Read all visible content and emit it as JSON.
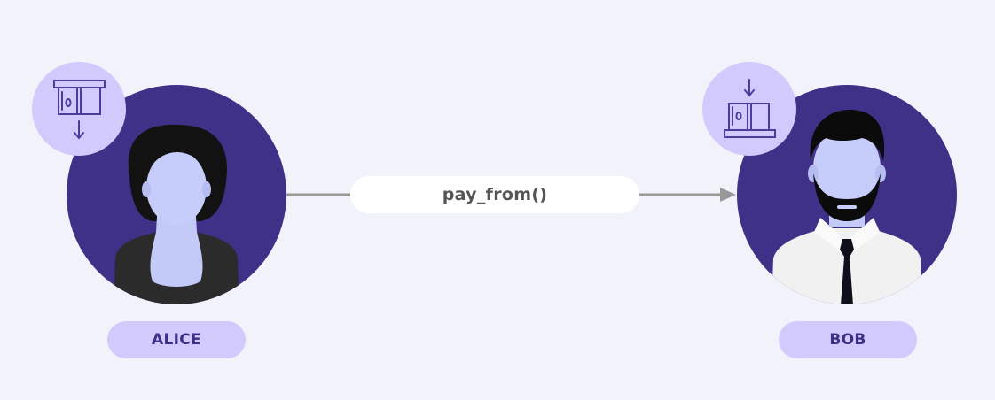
{
  "diagram": {
    "call": {
      "label": "pay_from()"
    },
    "sender": {
      "name": "ALICE",
      "badge_icon": "card-withdraw-icon"
    },
    "receiver": {
      "name": "BOB",
      "badge_icon": "card-deposit-icon"
    },
    "colors": {
      "background": "#f2f2fa",
      "avatar_circle": "#3f3187",
      "badge_circle": "#d2c9fc",
      "badge_icon": "#4a3d9c",
      "label_pill": "#d2c9fc",
      "label_text": "#3d2f87",
      "arrow": "#999999"
    }
  }
}
